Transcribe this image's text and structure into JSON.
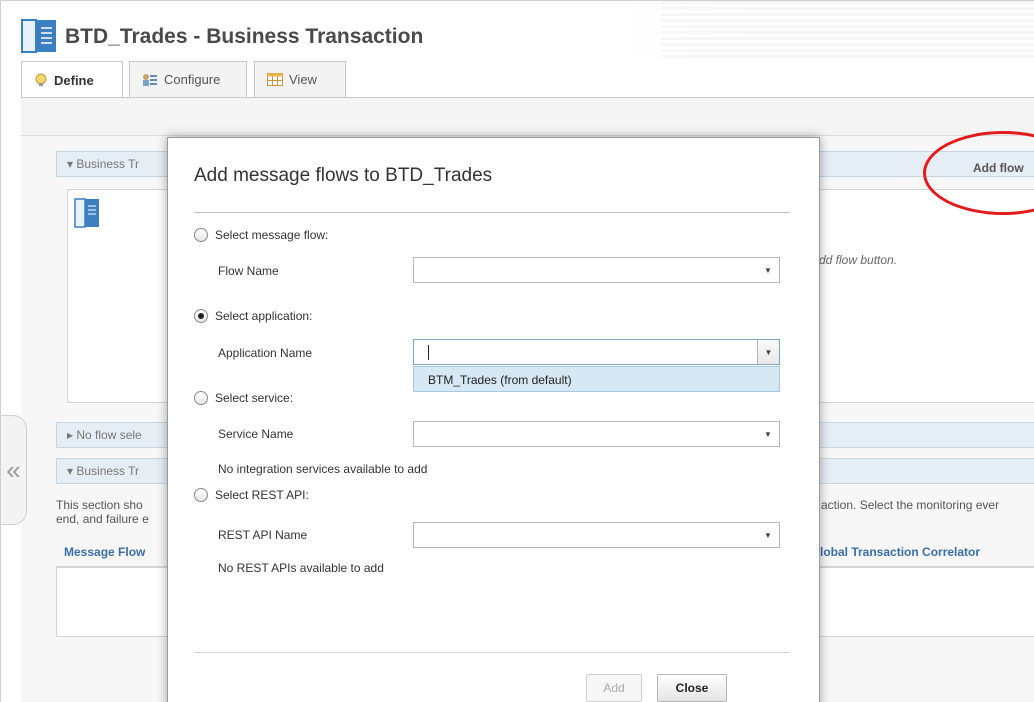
{
  "app": {
    "title": "BTD_Trades - Business Transaction",
    "tabs": [
      {
        "label": "Define",
        "icon": "lightbulb-icon"
      },
      {
        "label": "Configure",
        "icon": "configure-icon"
      },
      {
        "label": "View",
        "icon": "table-icon"
      }
    ],
    "sections": {
      "business_header_1": "▾ Business Tr",
      "no_flow_header": "▸ No flow sele",
      "business_header_2": "▾ Business Tr"
    },
    "add_flow_label": "Add flow",
    "hint_fragment": "dd flow button.",
    "description_left": [
      "This section sho",
      "end, and failure e"
    ],
    "description_right": "action. Select the monitoring ever",
    "table_headers": {
      "message_flow": "Message Flow",
      "global_correlator": "lobal Transaction Correlator"
    },
    "highlight_color": "#e01c1c"
  },
  "dialog": {
    "title": "Add message flows to BTD_Trades",
    "options": {
      "message_flow": {
        "label": "Select message flow:",
        "field_label": "Flow Name",
        "value": ""
      },
      "application": {
        "label": "Select application:",
        "field_label": "Application Name",
        "value": "",
        "dropdown_items": [
          "BTM_Trades (from default)"
        ]
      },
      "service": {
        "label": "Select service:",
        "field_label": "Service Name",
        "value": "",
        "note": "No integration services available to add"
      },
      "rest_api": {
        "label": "Select REST API:",
        "field_label": "REST API Name",
        "value": "",
        "note": "No REST APIs available to add"
      }
    },
    "selected_option": "application",
    "buttons": {
      "add": "Add",
      "close": "Close"
    }
  }
}
